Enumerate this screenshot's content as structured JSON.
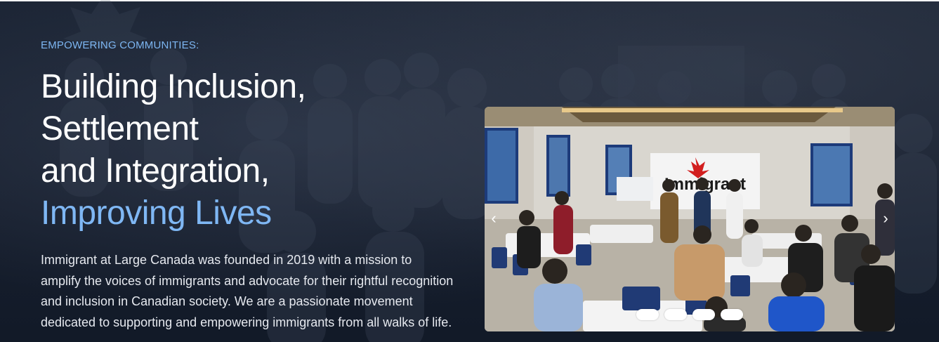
{
  "hero": {
    "eyebrow": "EMPOWERING COMMUNITIES:",
    "headline_lines": [
      "Building Inclusion,",
      "Settlement",
      "and Integration,"
    ],
    "headline_accent": "Improving Lives",
    "description": "Immigrant at Large Canada was founded in 2019 with a mission to amplify the voices of immigrants and advocate for their rightful recognition and inclusion in Canadian society. We are a passionate movement dedicated to supporting and empowering immigrants from all walks of life."
  },
  "slider": {
    "photo_alt": "Community gathering in a hall with an Immigrant at Large banner",
    "banner_text": "Immigrant",
    "prev_icon": "chevron-left-icon",
    "next_icon": "chevron-right-icon",
    "prev_glyph": "‹",
    "next_glyph": "›",
    "slide_count": 4,
    "active_slide": 1
  },
  "colors": {
    "accent": "#7fb7f4",
    "eyebrow": "#7db6f2",
    "background": "#161e2d",
    "text": "#e6e9ef"
  }
}
